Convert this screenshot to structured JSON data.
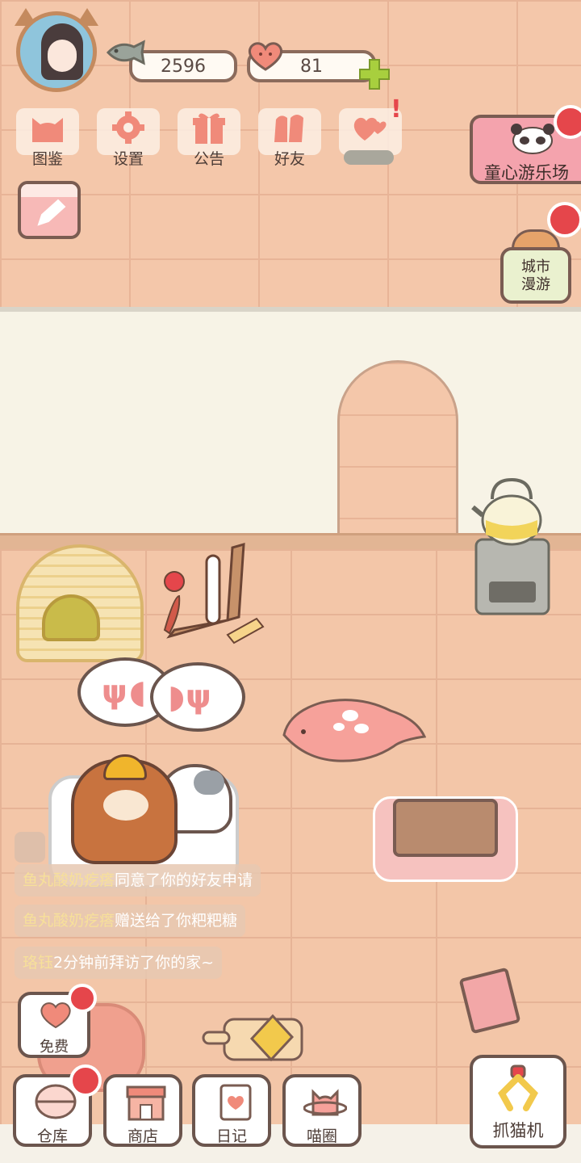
{
  "currency": {
    "fish": "2596",
    "hearts": "81"
  },
  "top_menu": [
    {
      "label": "图鉴"
    },
    {
      "label": "设置"
    },
    {
      "label": "公告"
    },
    {
      "label": "好友"
    },
    {
      "label": ""
    }
  ],
  "events": {
    "park_label": "童心游乐场",
    "city_label_line1": "城市",
    "city_label_line2": "漫游"
  },
  "notices": [
    {
      "name": "鱼丸酸奶疙瘩",
      "text": "同意了你的好友申请"
    },
    {
      "name": "鱼丸酸奶疙瘩",
      "text": "赠送给了你粑粑糖"
    },
    {
      "name": "珞钰",
      "text": "2分钟前拜访了你的家~"
    }
  ],
  "bottom_nav": {
    "free": "免费",
    "storage": "仓库",
    "shop": "商店",
    "diary": "日记",
    "circle": "喵圈",
    "claw_machine": "抓猫机"
  },
  "colors": {
    "accent_red": "#e5464b",
    "menu_pink": "#f08a7a",
    "plus_green": "#a8cf3e"
  }
}
